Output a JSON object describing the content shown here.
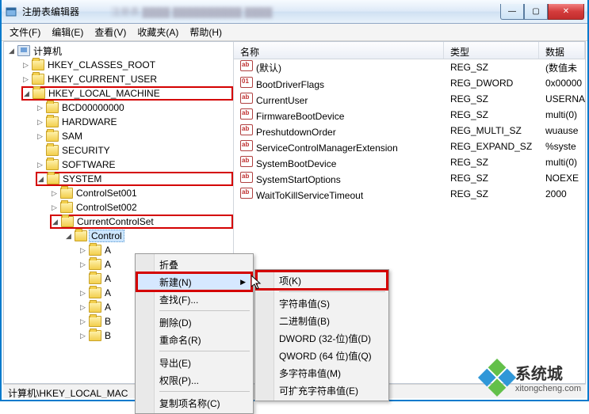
{
  "window": {
    "title": "注册表编辑器",
    "blurred_caption": "注册表  ▓▓▓▓ ▓▓▓▓▓▓▓▓▓▓ ▓▓▓▓",
    "btn_min": "—",
    "btn_max": "▢",
    "btn_close": "✕"
  },
  "menu": {
    "file": "文件(F)",
    "edit": "编辑(E)",
    "view": "查看(V)",
    "fav": "收藏夹(A)",
    "help": "帮助(H)"
  },
  "tree": {
    "root": "计算机",
    "hkcr": "HKEY_CLASSES_ROOT",
    "hkcu": "HKEY_CURRENT_USER",
    "hklm": "HKEY_LOCAL_MACHINE",
    "bcd": "BCD00000000",
    "hardware": "HARDWARE",
    "sam": "SAM",
    "security": "SECURITY",
    "software": "SOFTWARE",
    "system": "SYSTEM",
    "cs1": "ControlSet001",
    "cs2": "ControlSet002",
    "ccs": "CurrentControlSet",
    "control": "Control",
    "a1": "A",
    "a2": "A",
    "a3": "A",
    "a4": "A",
    "a5": "A",
    "a6": "B",
    "a7": "B"
  },
  "list": {
    "hdr_name": "名称",
    "hdr_type": "类型",
    "hdr_data": "数据",
    "rows": [
      {
        "n": "(默认)",
        "t": "REG_SZ",
        "d": "(数值未"
      },
      {
        "n": "BootDriverFlags",
        "t": "REG_DWORD",
        "d": "0x00000"
      },
      {
        "n": "CurrentUser",
        "t": "REG_SZ",
        "d": "USERNA"
      },
      {
        "n": "FirmwareBootDevice",
        "t": "REG_SZ",
        "d": "multi(0)"
      },
      {
        "n": "PreshutdownOrder",
        "t": "REG_MULTI_SZ",
        "d": "wuause"
      },
      {
        "n": "ServiceControlManagerExtension",
        "t": "REG_EXPAND_SZ",
        "d": "%syste"
      },
      {
        "n": "SystemBootDevice",
        "t": "REG_SZ",
        "d": "multi(0)"
      },
      {
        "n": "SystemStartOptions",
        "t": "REG_SZ",
        "d": " NOEXE"
      },
      {
        "n": "WaitToKillServiceTimeout",
        "t": "REG_SZ",
        "d": "2000"
      }
    ]
  },
  "ctx1": {
    "collapse": "折叠",
    "new": "新建(N)",
    "find": "查找(F)...",
    "delete": "删除(D)",
    "rename": "重命名(R)",
    "export": "导出(E)",
    "perm": "权限(P)...",
    "copyname": "复制项名称(C)"
  },
  "ctx2": {
    "key": "项(K)",
    "string": "字符串值(S)",
    "binary": "二进制值(B)",
    "dword": "DWORD (32-位)值(D)",
    "qword": "QWORD (64 位)值(Q)",
    "multi": "多字符串值(M)",
    "expand": "可扩充字符串值(E)"
  },
  "status": {
    "path": "计算机\\HKEY_LOCAL_MAC"
  },
  "watermark": {
    "main": "系统城",
    "sub": "xitongcheng.com"
  }
}
